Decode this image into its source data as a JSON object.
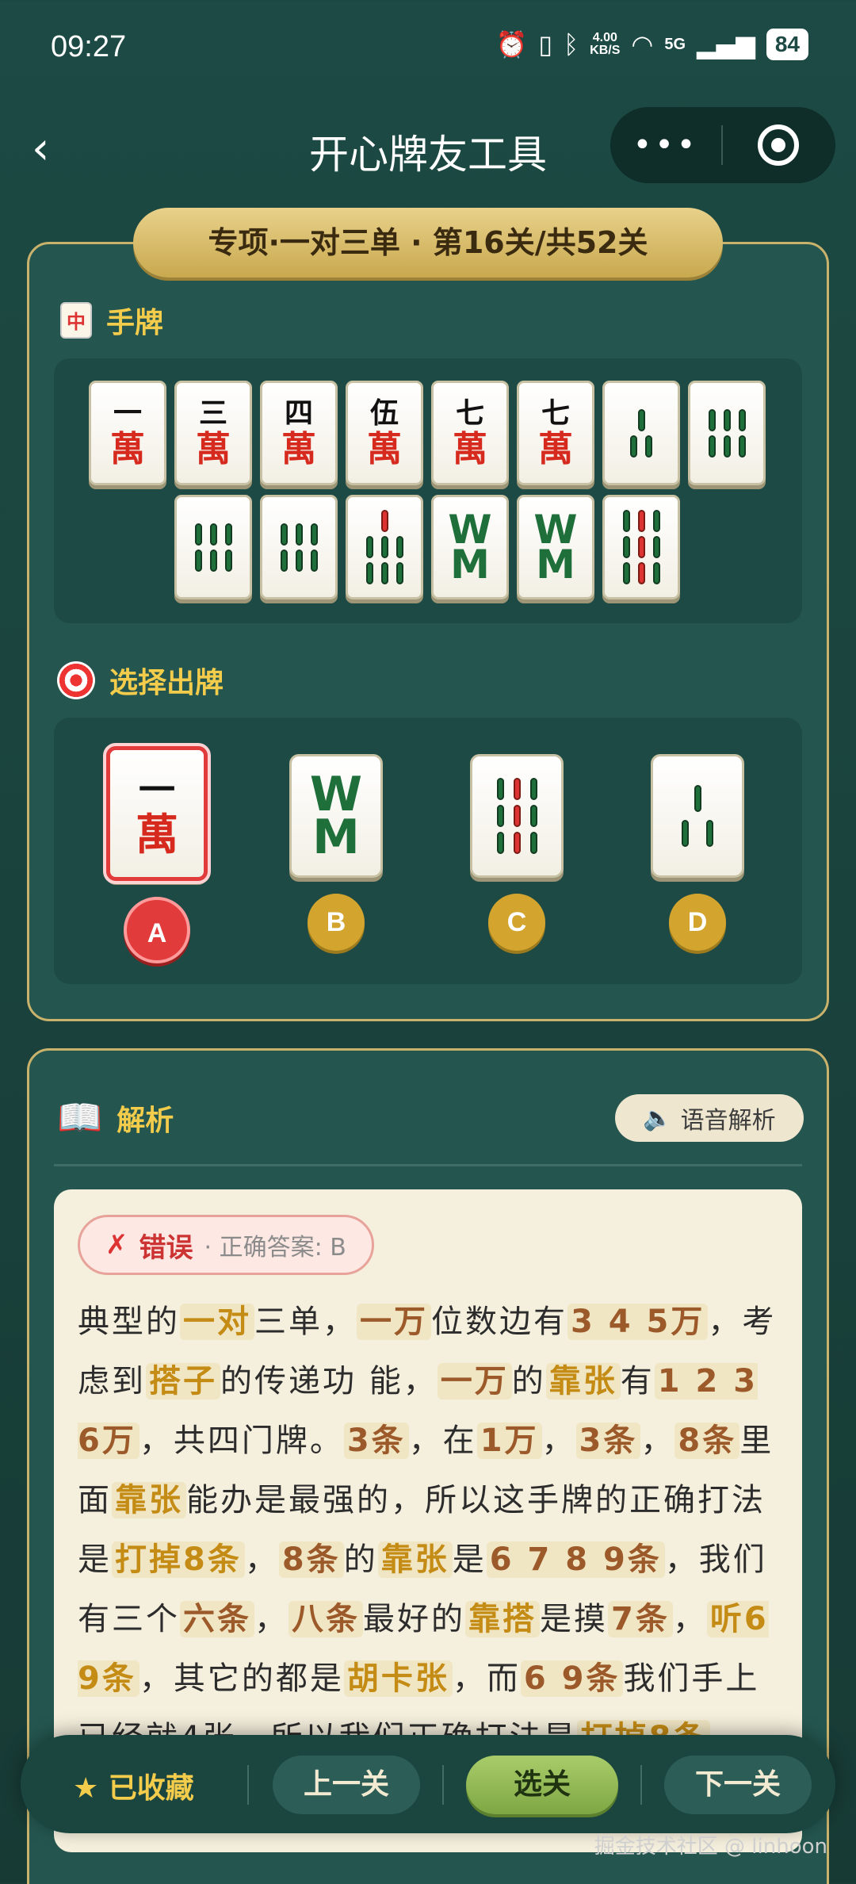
{
  "status_bar": {
    "time": "09:27",
    "net_speed_top": "4.00",
    "net_speed_bottom": "KB/S",
    "signal": "5G",
    "battery": "84"
  },
  "nav": {
    "title": "开心牌友工具",
    "more_label": "•••"
  },
  "level_banner": "专项·一对三单 · 第16关/共52关",
  "hand_section": {
    "icon_glyph": "中",
    "title": "手牌",
    "row1": [
      "一万",
      "三万",
      "四万",
      "伍万",
      "七万",
      "七万",
      "三条",
      "六条"
    ],
    "row2": [
      "六条",
      "六条",
      "七条",
      "八条",
      "八条",
      "九条"
    ]
  },
  "choice_section": {
    "title": "选择出牌",
    "options": [
      {
        "letter": "A",
        "tile": "一万",
        "selected": true
      },
      {
        "letter": "B",
        "tile": "八条",
        "selected": false
      },
      {
        "letter": "C",
        "tile": "九条",
        "selected": false
      },
      {
        "letter": "D",
        "tile": "三条",
        "selected": false
      }
    ]
  },
  "analysis": {
    "title": "解析",
    "voice_button": "语音解析",
    "result_label": "错误",
    "correct_answer": "· 正确答案: B",
    "text_fragments": [
      {
        "t": "典型的",
        "s": "n"
      },
      {
        "t": "一对",
        "s": "h"
      },
      {
        "t": "三单，",
        "s": "n"
      },
      {
        "t": "一万",
        "s": "h2"
      },
      {
        "t": "位数边有",
        "s": "n"
      },
      {
        "t": "3 4 5万",
        "s": "h2"
      },
      {
        "t": "，考虑到",
        "s": "n"
      },
      {
        "t": "搭子",
        "s": "h"
      },
      {
        "t": "的传递功 能，",
        "s": "n"
      },
      {
        "t": "一万",
        "s": "h2"
      },
      {
        "t": "的",
        "s": "n"
      },
      {
        "t": "靠张",
        "s": "h"
      },
      {
        "t": "有",
        "s": "n"
      },
      {
        "t": "1 2 3 6万",
        "s": "h2"
      },
      {
        "t": "，共四门牌。",
        "s": "n"
      },
      {
        "t": "3条",
        "s": "h2"
      },
      {
        "t": "，在",
        "s": "n"
      },
      {
        "t": "1万",
        "s": "h2"
      },
      {
        "t": "，",
        "s": "n"
      },
      {
        "t": "3条",
        "s": "h2"
      },
      {
        "t": "，",
        "s": "n"
      },
      {
        "t": "8条",
        "s": "h2"
      },
      {
        "t": "里面",
        "s": "n"
      },
      {
        "t": "靠张",
        "s": "h"
      },
      {
        "t": "能办是最强的，所以这手牌的正确打法是",
        "s": "n"
      },
      {
        "t": "打掉8条",
        "s": "h"
      },
      {
        "t": "，",
        "s": "n"
      },
      {
        "t": "8条",
        "s": "h2"
      },
      {
        "t": "的",
        "s": "n"
      },
      {
        "t": "靠张",
        "s": "h"
      },
      {
        "t": "是",
        "s": "n"
      },
      {
        "t": "6 7 8 9条",
        "s": "h2"
      },
      {
        "t": "，我们有三个",
        "s": "n"
      },
      {
        "t": "六条",
        "s": "h2"
      },
      {
        "t": "，",
        "s": "n"
      },
      {
        "t": "八条",
        "s": "h2"
      },
      {
        "t": "最好的",
        "s": "n"
      },
      {
        "t": "靠搭",
        "s": "h"
      },
      {
        "t": "是摸",
        "s": "n"
      },
      {
        "t": "7条",
        "s": "h2"
      },
      {
        "t": "，",
        "s": "n"
      },
      {
        "t": "听6 9条",
        "s": "h"
      },
      {
        "t": "，其它的都是",
        "s": "n"
      },
      {
        "t": "胡卡张",
        "s": "h"
      },
      {
        "t": "，而",
        "s": "n"
      },
      {
        "t": "6 9条",
        "s": "h2"
      },
      {
        "t": "我们手上已经就4张，所以我们正确打法是",
        "s": "n"
      },
      {
        "t": "打掉8条",
        "s": "h"
      },
      {
        "t": "。",
        "s": "n"
      }
    ]
  },
  "bottom_bar": {
    "favorite": "★ 已收藏",
    "prev": "上一关",
    "select": "选关",
    "next": "下一关"
  },
  "watermark": "掘金技术社区 @ linhoon",
  "colors": {
    "background": "#1d4a44",
    "panel_border": "#c9b26b",
    "accent_gold": "#f3cc4c",
    "error_red": "#e23b3b",
    "primary_green": "#7ea744"
  }
}
